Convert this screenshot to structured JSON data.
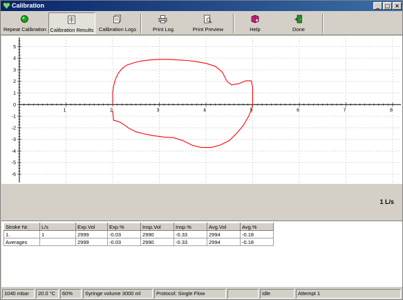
{
  "window": {
    "title": "Calibration"
  },
  "window_buttons": {
    "minimize": "_",
    "maximize": "□",
    "close": "×"
  },
  "toolbar": {
    "buttons": [
      {
        "label": "Repeat Calibration",
        "icon": "green-circle-icon"
      },
      {
        "label": "Calibration Results",
        "icon": "document-icon",
        "pressed": true
      },
      {
        "label": "Calibration Logs",
        "icon": "pages-icon"
      },
      {
        "label": "Print Log",
        "icon": "printer-icon"
      },
      {
        "label": "Print Preview",
        "icon": "magnifier-page-icon"
      },
      {
        "label": "Help",
        "icon": "help-book-icon"
      },
      {
        "label": "Done",
        "icon": "exit-door-icon"
      }
    ]
  },
  "chart_data": {
    "type": "line",
    "x_ticks": [
      "1",
      "2",
      "3",
      "4",
      "5",
      "6",
      "7",
      "8"
    ],
    "y_ticks": [
      "5",
      "4",
      "3",
      "2",
      "1",
      "0",
      "-1",
      "-2",
      "-3",
      "-4",
      "-5",
      "-6"
    ],
    "xlim": [
      0,
      8
    ],
    "ylim": [
      -6,
      5.5
    ],
    "grid": true,
    "series": [
      {
        "color": "#ff0000",
        "x": [
          2.0,
          2.0,
          2.02,
          2.06,
          2.12,
          2.2,
          2.3,
          2.45,
          2.6,
          2.8,
          3.0,
          3.2,
          3.4,
          3.6,
          3.8,
          4.0,
          4.2,
          4.35,
          4.45,
          4.55,
          4.7,
          4.85,
          4.97,
          5.0,
          5.0,
          4.97,
          4.9,
          4.8,
          4.65,
          4.5,
          4.3,
          4.1,
          3.9,
          3.7,
          3.5,
          3.3,
          3.1,
          2.9,
          2.7,
          2.5,
          2.35,
          2.25,
          2.15,
          2.07,
          2.02,
          2.0
        ],
        "y": [
          0,
          1.0,
          1.6,
          2.2,
          2.7,
          3.1,
          3.4,
          3.6,
          3.75,
          3.85,
          3.9,
          3.9,
          3.85,
          3.8,
          3.7,
          3.55,
          3.3,
          2.8,
          2.0,
          1.7,
          1.8,
          2.05,
          2.05,
          1.5,
          0,
          -0.5,
          -1.1,
          -1.8,
          -2.5,
          -3.1,
          -3.5,
          -3.7,
          -3.7,
          -3.5,
          -3.1,
          -2.85,
          -2.8,
          -2.7,
          -2.55,
          -2.35,
          -2.05,
          -1.75,
          -1.5,
          -1.4,
          -1.35,
          -0.5
        ]
      }
    ],
    "unit_label": "1 L/s"
  },
  "table": {
    "headers": [
      "Stroke Nr.",
      "L/s",
      "Exp.Vol",
      "Exp.%",
      "Insp.Vol",
      "Insp.%",
      "Avg.Vol",
      "Avg.%"
    ],
    "rows": [
      [
        "1.",
        "1",
        "2999",
        "-0.03",
        "2990",
        "-0.33",
        "2994",
        "-0.18"
      ],
      [
        "Averages",
        "",
        "2999",
        "-0.03",
        "2990",
        "-0.33",
        "2994",
        "-0.18"
      ]
    ]
  },
  "status": {
    "pressure": "1040 mbar",
    "temperature": "20.0 °C",
    "humidity": "60%",
    "syringe": "Syringe volume 3000 ml",
    "protocol": "Protocol: Single Flow",
    "empty": "",
    "state": "Idle",
    "attempt": "Attempt 1"
  }
}
